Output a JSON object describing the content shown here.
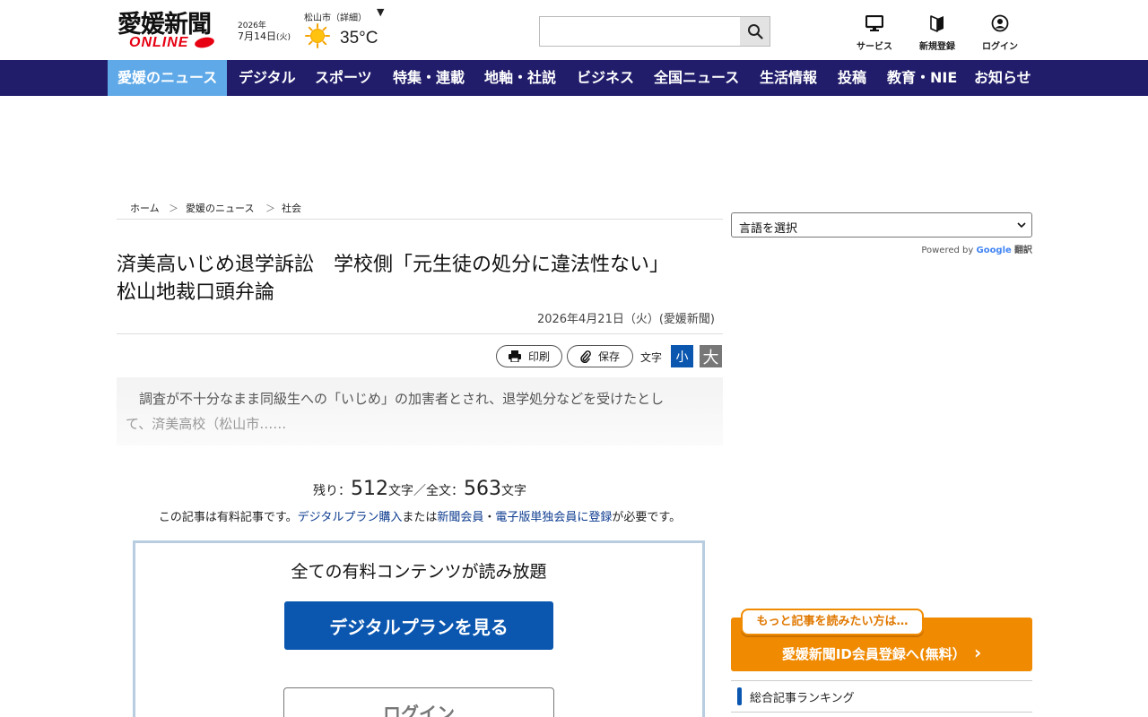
{
  "header": {
    "logo_text": "愛媛新聞",
    "logo_sub": "ONLINE",
    "date_year": "2026年",
    "date_monthday": "7月14日",
    "date_weekday": "(火)",
    "weather_location": "松山市（詳細）",
    "weather_caret": "▼",
    "temperature": "35°C",
    "search_placeholder": "",
    "icons": [
      {
        "label": "サービス",
        "icon": "monitor-icon"
      },
      {
        "label": "新規登録",
        "icon": "beginner-mark-icon"
      },
      {
        "label": "ログイン",
        "icon": "user-icon"
      }
    ]
  },
  "nav": {
    "items": [
      "愛媛のニュース",
      "デジタル",
      "スポーツ",
      "特集・連載",
      "地軸・社説",
      "ビジネス",
      "全国ニュース",
      "生活情報",
      "投稿",
      "教育・NIE",
      "お知らせ"
    ],
    "active_index": 0
  },
  "breadcrumb": {
    "items": [
      "ホーム",
      "愛媛のニュース",
      "社会"
    ],
    "separator": "＞"
  },
  "article": {
    "title_line1": "済美高いじめ退学訴訟　学校側「元生徒の処分に違法性ない」",
    "title_line2": "松山地裁口頭弁論",
    "byline": "2026年4月21日（火）(愛媛新聞)",
    "tools": {
      "print_label": "印刷",
      "save_label": "保存",
      "font_size_label": "文字",
      "small_label": "小",
      "large_label": "大"
    },
    "lead_line1": "　調査が不十分なまま同級生への「いじめ」の加害者とされ、退学処分などを受けたとし",
    "lead_line2": "て、済美高校（松山市……"
  },
  "paywall": {
    "remain_prefix": "残り：",
    "remain_count": "512",
    "remain_mid": "文字／全文：",
    "total_count": "563",
    "remain_suffix": "文字",
    "note_prefix": "この記事は有料記事です。",
    "note_link1": "デジタルプラン購入",
    "note_mid1": "または",
    "note_link2": "新聞会員",
    "note_mid2": "・",
    "note_link3": "電子版単独会員に登録",
    "note_suffix": "が必要です。",
    "plan_heading": "全ての有料コンテンツが読み放題",
    "plan_button": "デジタルプランを見る",
    "login_button": "ログイン"
  },
  "sidebar": {
    "language_select": "言語を選択",
    "powered_by": "Powered by",
    "google": "Google",
    "translate": "翻訳",
    "register_bubble": "もっと記事を読みたい方は…",
    "register_text": "愛媛新聞ID会員登録へ(無料）",
    "register_arrow": "›",
    "ranking_label": "総合記事ランキング"
  },
  "colors": {
    "nav_bg": "#211d6b",
    "nav_active": "#5fa9e8",
    "plan_button": "#0b57b0",
    "register_orange": "#f08a00",
    "logo_red": "#e60012"
  }
}
